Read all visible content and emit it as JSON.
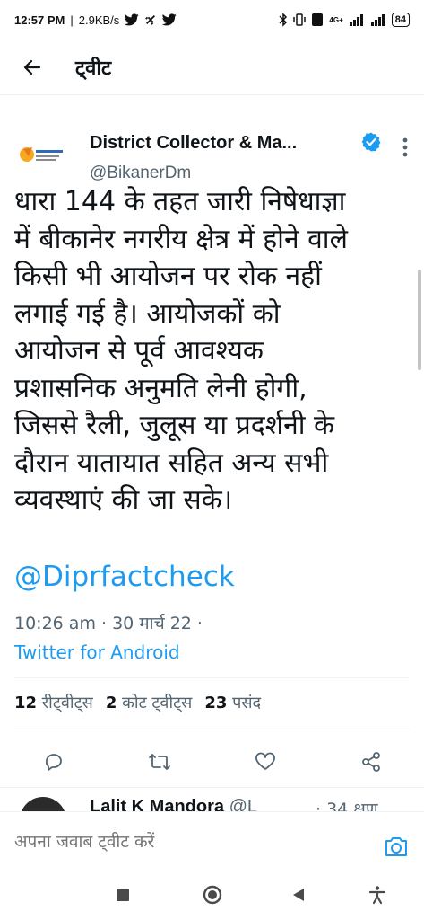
{
  "status_bar": {
    "time": "12:57 PM",
    "speed": "2.9KB/s",
    "network_label": "4G+",
    "battery": "84"
  },
  "header": {
    "title": "ट्वीट"
  },
  "tweet": {
    "author_name": "District Collector & Ma...",
    "author_handle": "@BikanerDm",
    "text": "धारा 144 के तहत जारी निषेधाज्ञा\nमें बीकानेर नगरीय क्षेत्र में होने वाले\nकिसी भी आयोजन पर रोक नहीं\nलगाई गई है। आयोजकों को\nआयोजन से पूर्व आवश्यक\nप्रशासनिक अनुमति लेनी होगी,\nजिससे रैली, जुलूस या प्रदर्शनी के\nदौरान यातायात सहित अन्य सभी\nव्यवस्थाएं की जा सके।",
    "mention": "@Diprfactcheck",
    "time": "10:26 am",
    "date": "30 मार्च 22",
    "source": "Twitter for Android",
    "stats": {
      "retweets_count": "12",
      "retweets_label": "रीट्वीट्स",
      "quotes_count": "2",
      "quotes_label": "कोट ट्वीट्स",
      "likes_count": "23",
      "likes_label": "पसंद"
    }
  },
  "reply_preview": {
    "name": "Lalit K Mandora",
    "handle": "@L",
    "time": "· 34 क्षण"
  },
  "compose": {
    "placeholder": "अपना जवाब ट्वीट करें"
  },
  "colors": {
    "accent": "#1d9bf0",
    "text": "#0f1419",
    "muted": "#536471"
  }
}
